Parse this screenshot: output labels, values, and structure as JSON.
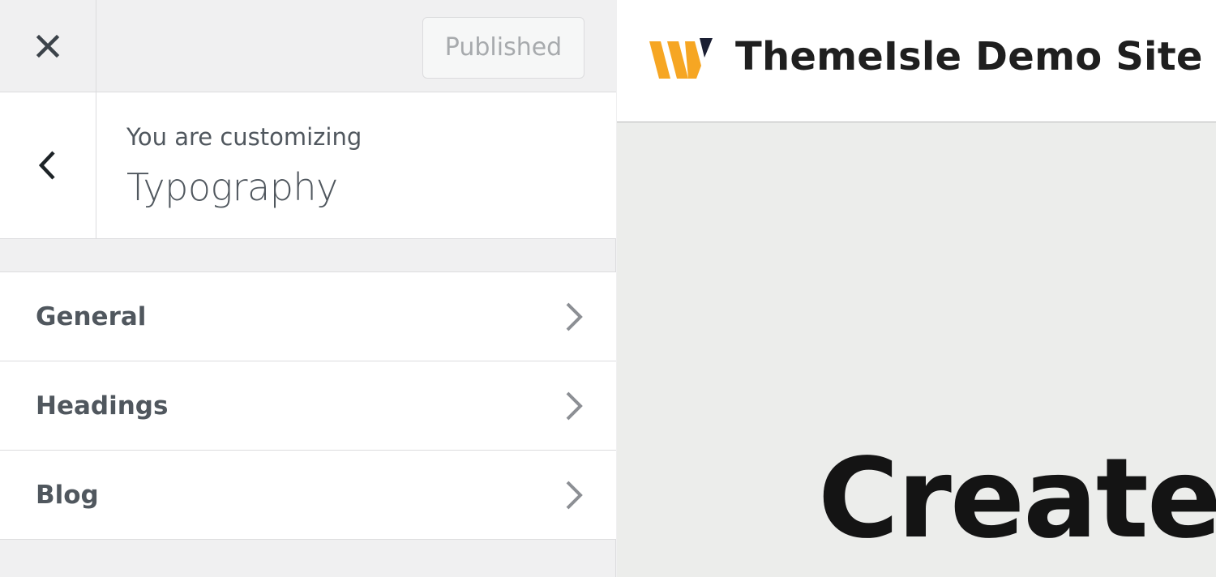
{
  "customizer": {
    "publish_label": "Published",
    "customizing_label": "You are customizing",
    "section_title": "Typography",
    "menu_items": [
      {
        "label": "General"
      },
      {
        "label": "Headings"
      },
      {
        "label": "Blog"
      }
    ]
  },
  "preview": {
    "site_title": "ThemeIsle Demo Site",
    "hero_heading": "Create",
    "logo_colors": {
      "primary": "#f6a623",
      "accent": "#1b1f33"
    }
  }
}
